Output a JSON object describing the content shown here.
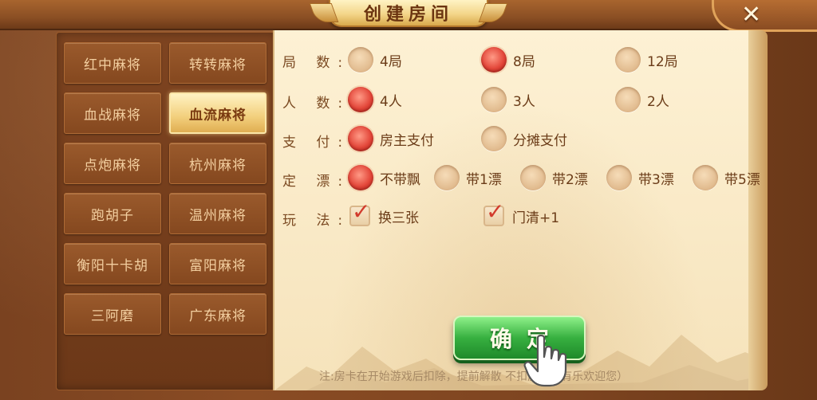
{
  "title": "创建房间",
  "close": {
    "icon": "close-icon",
    "glyph": "✕"
  },
  "game_types": [
    {
      "label": "红中麻将",
      "active": false
    },
    {
      "label": "转转麻将",
      "active": false
    },
    {
      "label": "血战麻将",
      "active": false
    },
    {
      "label": "血流麻将",
      "active": true
    },
    {
      "label": "点炮麻将",
      "active": false
    },
    {
      "label": "杭州麻将",
      "active": false
    },
    {
      "label": "跑胡子",
      "active": false
    },
    {
      "label": "温州麻将",
      "active": false
    },
    {
      "label": "衡阳十卡胡",
      "active": false
    },
    {
      "label": "富阳麻将",
      "active": false
    },
    {
      "label": "三阿磨",
      "active": false
    },
    {
      "label": "广东麻将",
      "active": false
    }
  ],
  "rounds": {
    "label": "局 数:",
    "options": [
      "4局",
      "8局",
      "12局"
    ],
    "selected": "8局"
  },
  "players": {
    "label": "人 数:",
    "options": [
      "4人",
      "3人",
      "2人"
    ],
    "selected": "4人"
  },
  "payment": {
    "label": "支 付:",
    "options": [
      "房主支付",
      "分摊支付"
    ],
    "selected": "房主支付"
  },
  "piao": {
    "label": "定 漂:",
    "options": [
      "不带飘",
      "带1漂",
      "带2漂",
      "带3漂",
      "带5漂"
    ],
    "selected": "不带飘"
  },
  "rules": {
    "label": "玩 法:",
    "options": [
      "换三张",
      "门清+1"
    ],
    "checked": [
      "换三张",
      "门清+1"
    ]
  },
  "confirm_label": "确定",
  "note": "注:房卡在开始游戏后扣除，提前解散 不扣房卡（有乐欢迎您）",
  "colors": {
    "accent_red": "#e3473a",
    "confirm_green": "#37b040",
    "wood": "#7a4220",
    "parchment": "#fdf1d4"
  }
}
